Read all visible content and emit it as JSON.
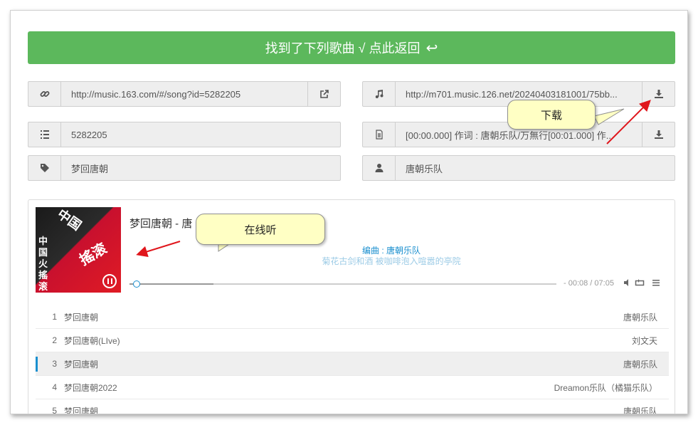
{
  "header": {
    "back_label": "找到了下列歌曲 √ 点此返回",
    "back_icon": "reply-arrow-icon"
  },
  "fields": {
    "link": {
      "icon": "link-icon",
      "value": "http://music.163.com/#/song?id=5282205",
      "action_icon": "external-link-icon"
    },
    "mp3": {
      "icon": "music-note-icon",
      "value": "http://m701.music.126.net/20240403181001/75bb...",
      "action_icon": "download-icon"
    },
    "song_id": {
      "icon": "list-icon",
      "value": "5282205"
    },
    "lrc": {
      "icon": "file-text-icon",
      "value": "[00:00.000] 作词 : 唐朝乐队/万無行[00:01.000] 作...",
      "action_icon": "download-icon"
    },
    "title": {
      "icon": "tag-icon",
      "value": "梦回唐朝"
    },
    "artist": {
      "icon": "user-icon",
      "value": "唐朝乐队"
    }
  },
  "player": {
    "song_title": "梦回唐朝 - 唐",
    "lyric_current": "编曲 : 唐朝乐队",
    "lyric_next": "菊花古剑和酒 被咖啡泡入喧嚣的亭院",
    "time": "- 00:08 / 07:05",
    "progress_fraction": 0.02,
    "cover_text": {
      "a": "中国",
      "b": "中国火搖滚",
      "c": "搖滚"
    }
  },
  "playlist": [
    {
      "num": "1",
      "name": "梦回唐朝",
      "artist": "唐朝乐队",
      "active": false
    },
    {
      "num": "2",
      "name": "梦回唐朝(LIve)",
      "artist": "刘文天",
      "active": false
    },
    {
      "num": "3",
      "name": "梦回唐朝",
      "artist": "唐朝乐队",
      "active": true
    },
    {
      "num": "4",
      "name": "梦回唐朝2022",
      "artist": "Dreamon乐队（橘猫乐队）",
      "active": false
    },
    {
      "num": "5",
      "name": "梦回唐朝",
      "artist": "唐朝乐队",
      "active": false
    }
  ],
  "annotations": {
    "download": "下载",
    "listen": "在线听"
  },
  "colors": {
    "accent": "#5cb85c",
    "link": "#1a8fcf",
    "arrow": "#e0161c",
    "callout": "#ffffc4"
  }
}
